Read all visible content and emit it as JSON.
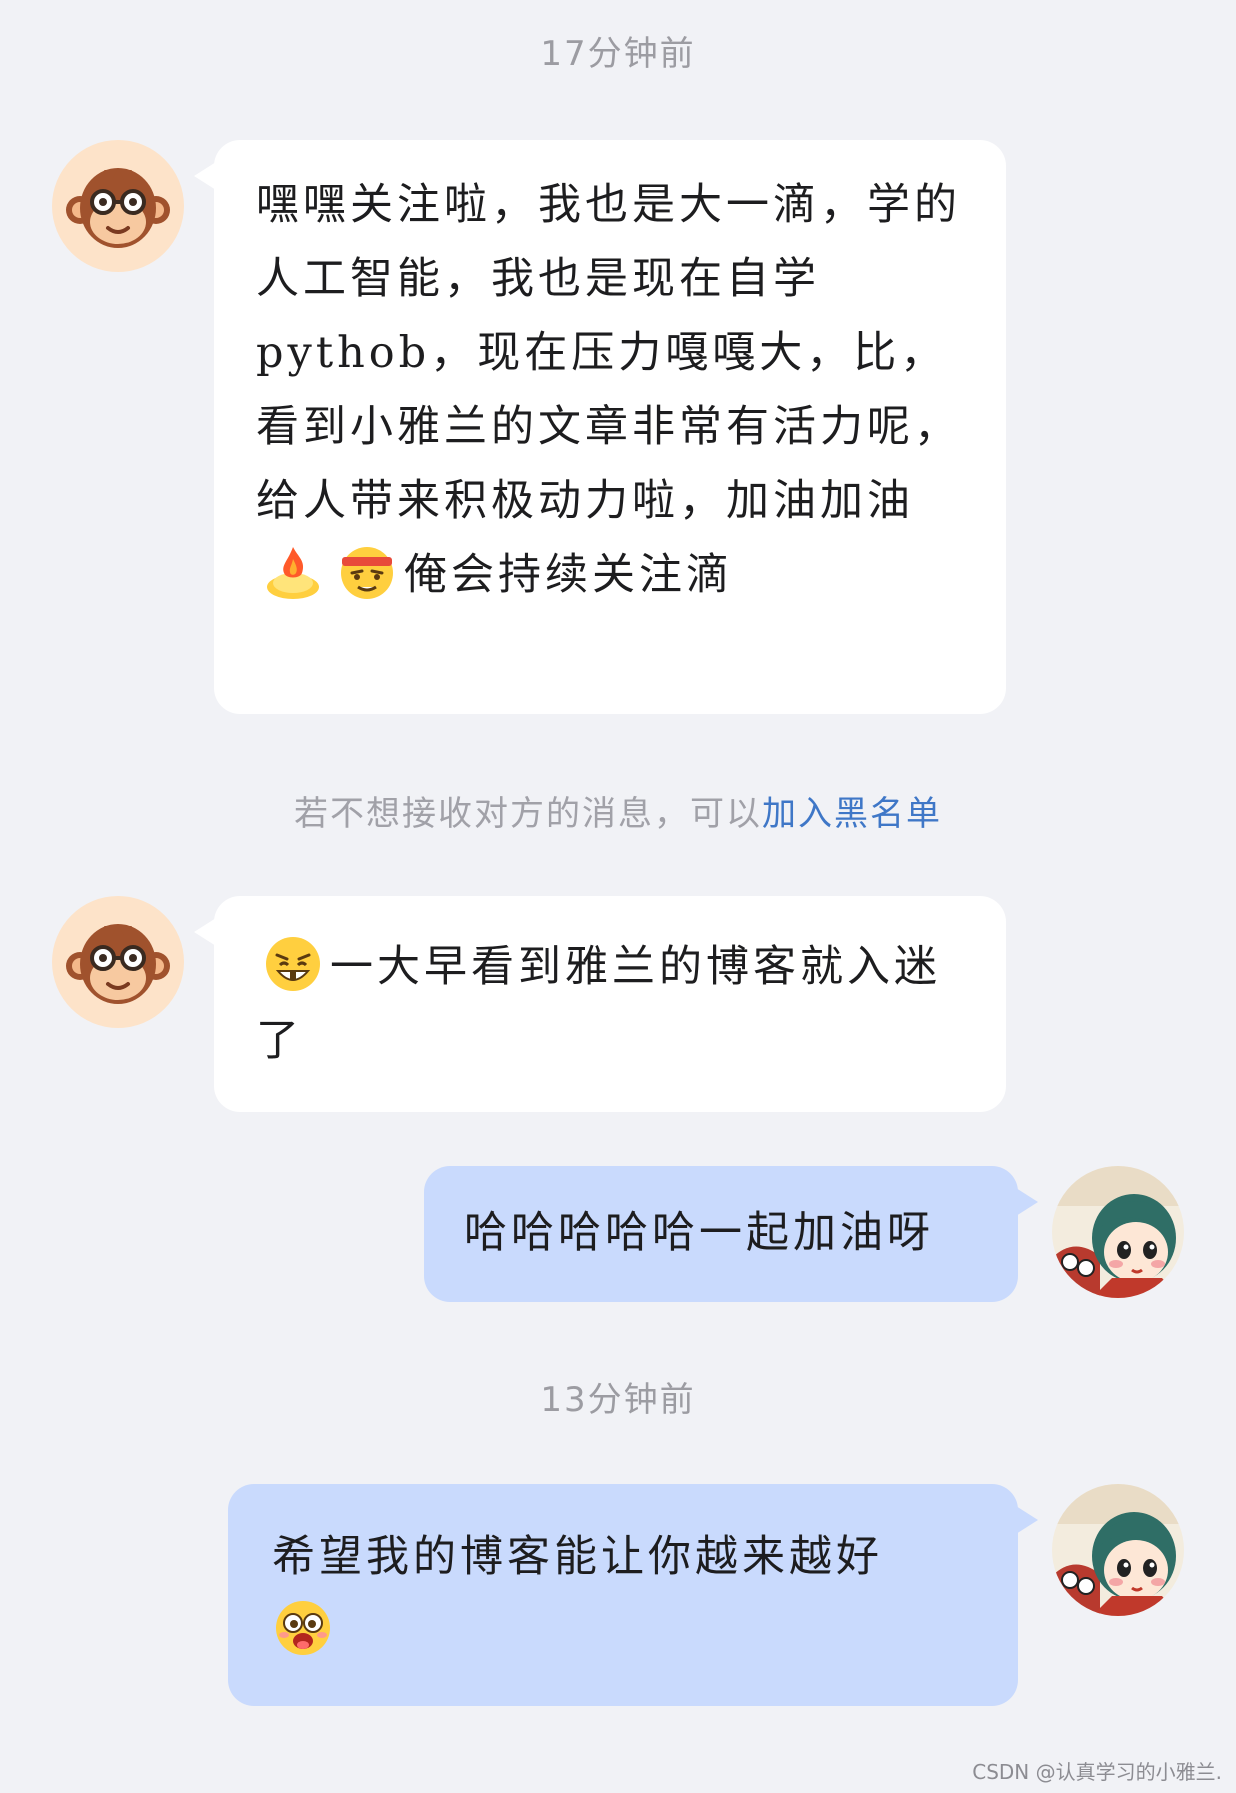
{
  "timestamps": [
    "17分钟前",
    "13分钟前"
  ],
  "system_tip": {
    "text": "若不想接收对方的消息，可以",
    "link": "加入黑名单"
  },
  "messages": [
    {
      "from": "other",
      "avatar": "monkey-avatar",
      "text_1": "嘿嘿关注啦，我也是大一滴，学的人工智能，我也是现在自学pythob，现在压力嘎嘎大，比，看到小雅兰的文章非常有活力呢，给人带来积极动力啦，加油加油",
      "emoji_1": "fire-emoji",
      "emoji_2": "determined-face-emoji",
      "text_2": "俺会持续关注滴"
    },
    {
      "from": "other",
      "avatar": "monkey-avatar",
      "emoji_1": "grinning-face-emoji",
      "text_1": "一大早看到雅兰的博客就入迷了"
    },
    {
      "from": "me",
      "avatar": "girl-avatar",
      "text_1": "哈哈哈哈哈一起加油呀"
    },
    {
      "from": "me",
      "avatar": "girl-avatar",
      "text_1": "希望我的博客能让你越来越好",
      "emoji_1": "excited-face-emoji"
    }
  ],
  "watermark": "CSDN @认真学习的小雅兰.",
  "colors": {
    "background": "#f1f2f6",
    "incoming_bubble": "#ffffff",
    "outgoing_bubble": "#c9dafd",
    "link": "#3f77c7"
  }
}
